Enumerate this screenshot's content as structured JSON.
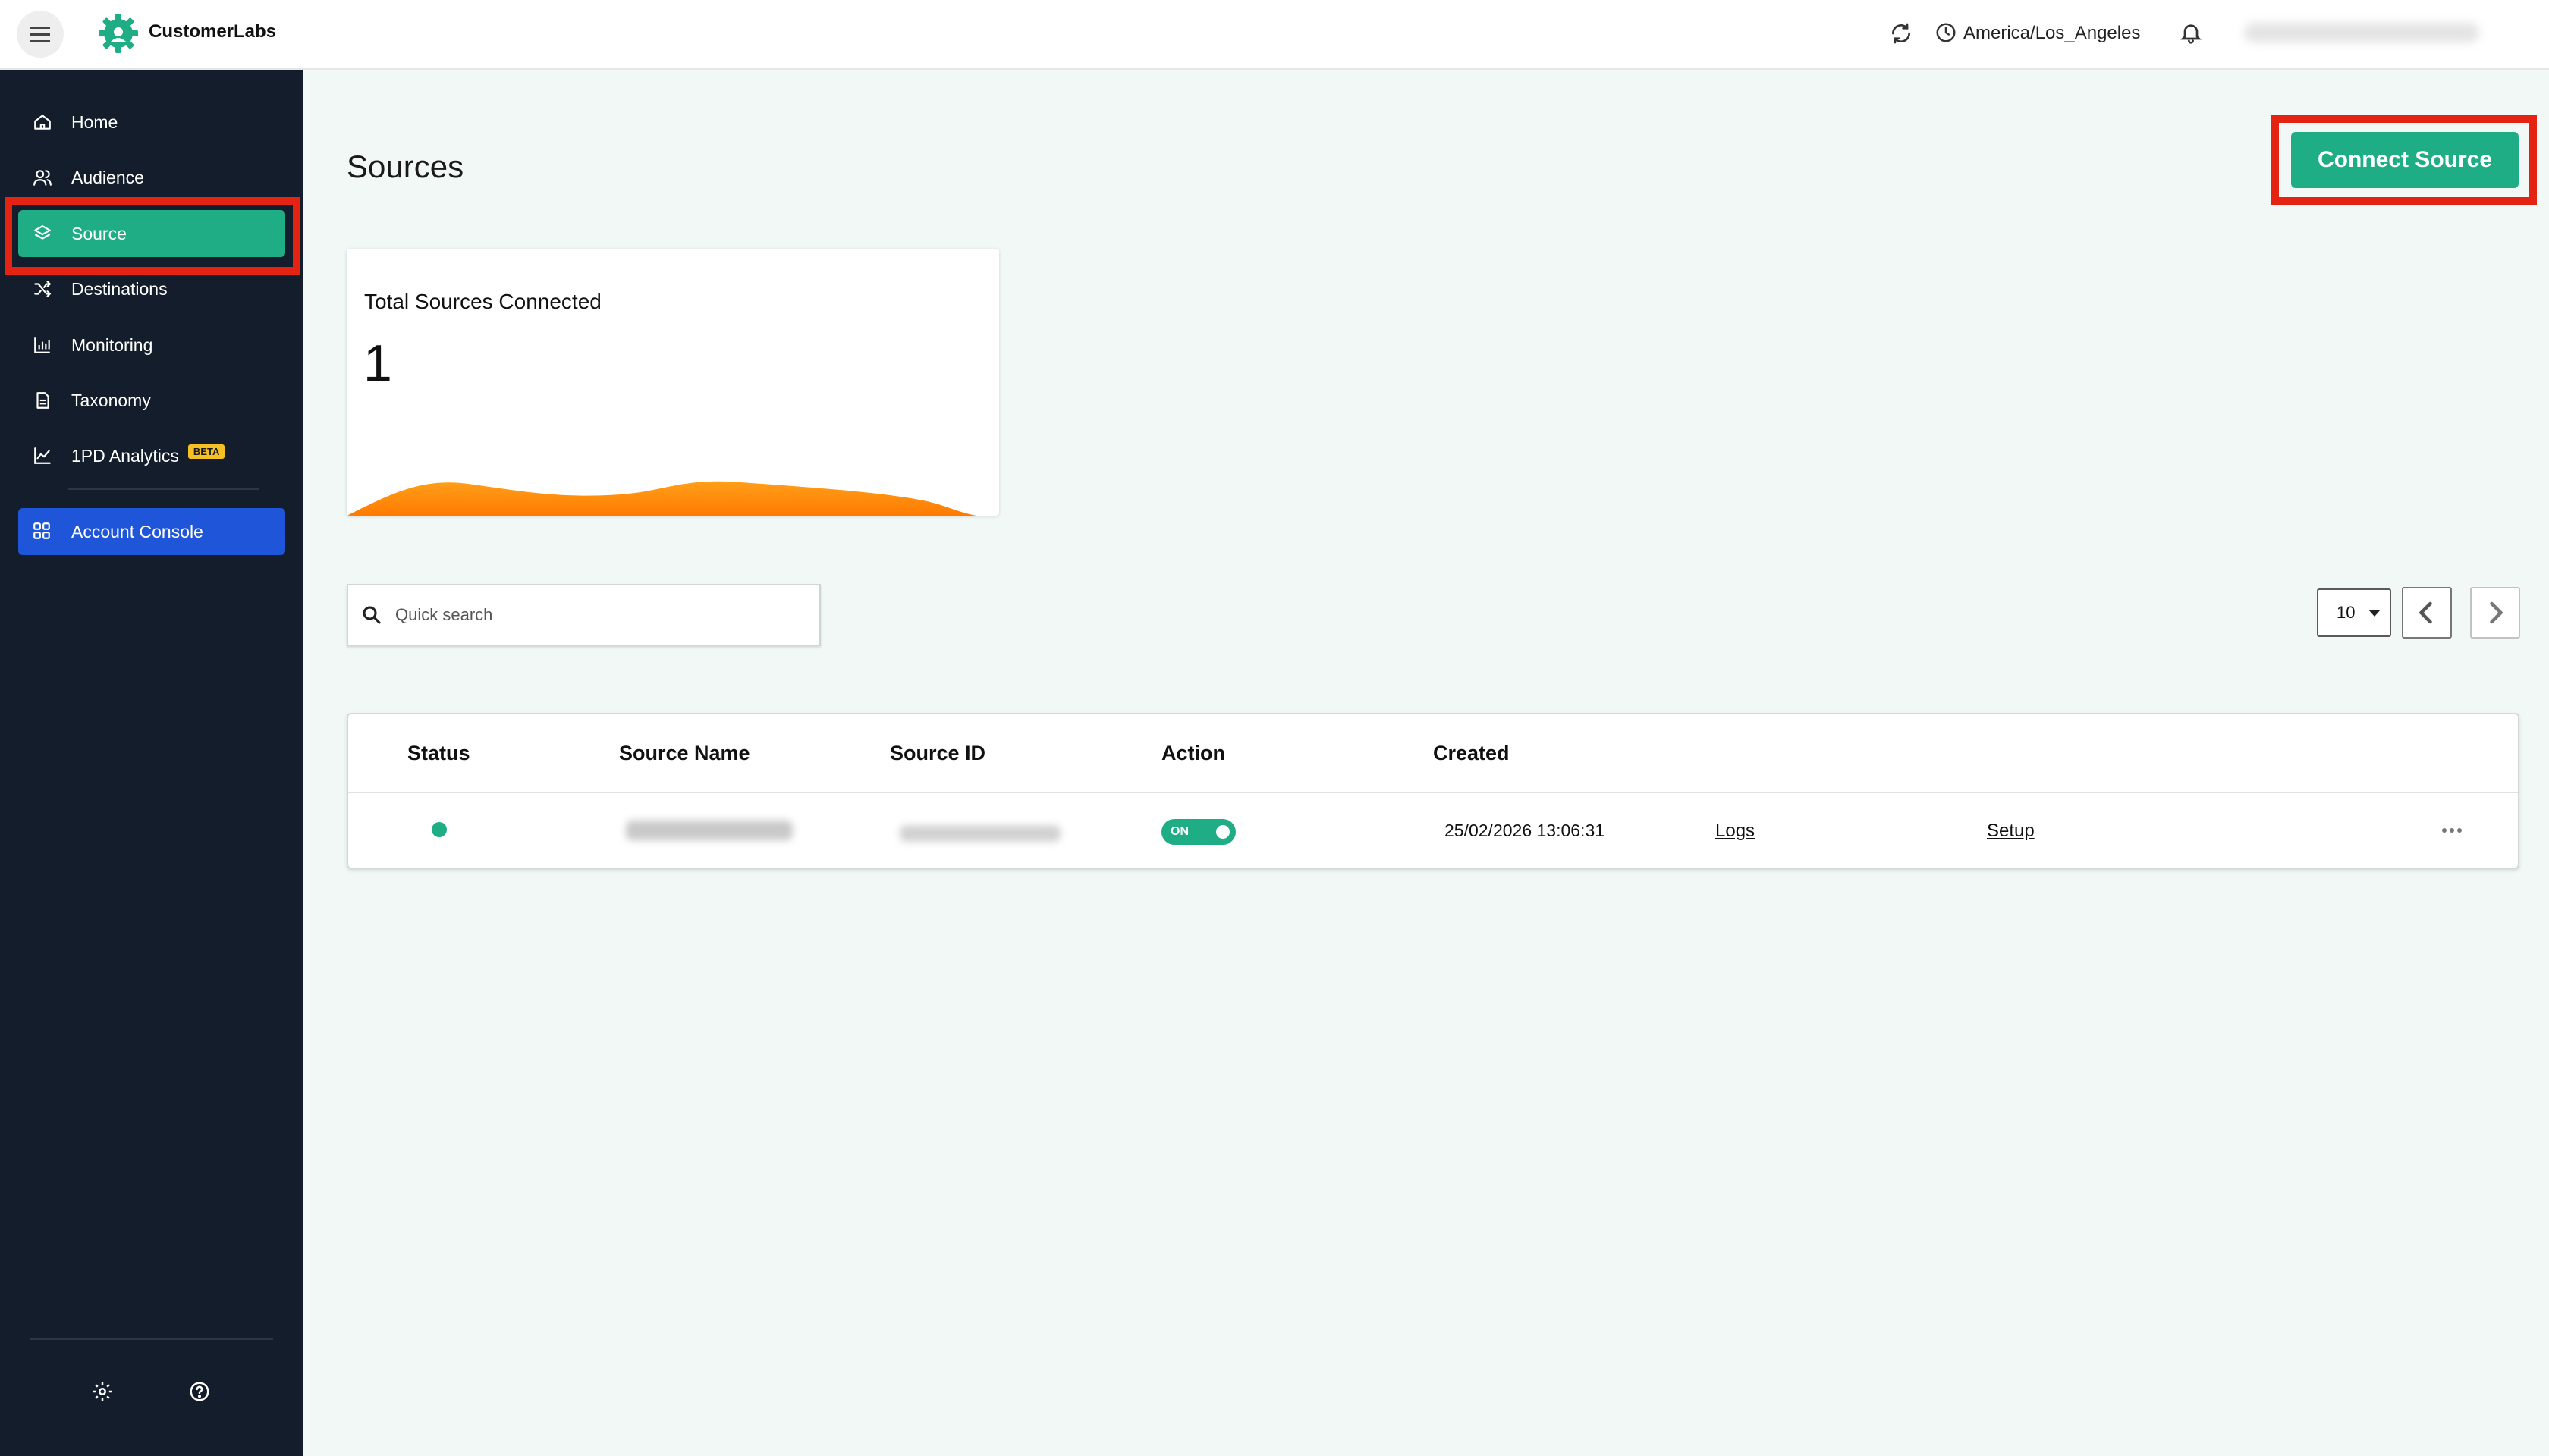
{
  "app": {
    "name": "CustomerLabs",
    "brand_color": "#1fad85",
    "sidebar_bg": "#131d2b",
    "highlight_color": "#e42313"
  },
  "topbar": {
    "timezone": "America/Los_Angeles",
    "icons": [
      "menu-icon",
      "logo-icon",
      "refresh-icon",
      "clock-icon",
      "bell-icon"
    ]
  },
  "sidebar": {
    "items": [
      {
        "label": "Home",
        "icon": "home-icon"
      },
      {
        "label": "Audience",
        "icon": "audience-icon"
      },
      {
        "label": "Source",
        "icon": "layers-icon",
        "active": true
      },
      {
        "label": "Destinations",
        "icon": "shuffle-icon"
      },
      {
        "label": "Monitoring",
        "icon": "bar-chart-icon"
      },
      {
        "label": "Taxonomy",
        "icon": "document-icon"
      },
      {
        "label": "1PD Analytics",
        "icon": "line-chart-icon",
        "badge": "BETA"
      }
    ],
    "console_label": "Account Console",
    "footer_icons": [
      "gear-icon",
      "help-icon"
    ]
  },
  "main": {
    "title": "Sources",
    "connect_label": "Connect Source",
    "stat": {
      "label": "Total Sources Connected",
      "value": "1"
    },
    "search": {
      "placeholder": "Quick search"
    },
    "pagination": {
      "page_size": "10"
    },
    "table": {
      "columns": [
        "Status",
        "Source Name",
        "Source ID",
        "Action",
        "Created"
      ],
      "rows": [
        {
          "status": "active",
          "action": "ON",
          "created": "25/02/2026 13:06:31",
          "logs": "Logs",
          "setup": "Setup"
        }
      ]
    }
  }
}
